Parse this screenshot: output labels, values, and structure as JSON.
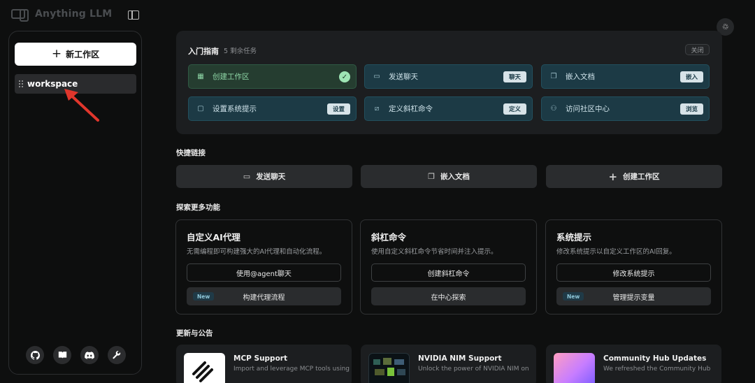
{
  "app": {
    "logo_text": "Anything LLM"
  },
  "sidebar": {
    "new_workspace_label": "新工作区",
    "workspaces": [
      {
        "name": "workspace"
      }
    ],
    "footer_icons": [
      "github-icon",
      "docs-book-icon",
      "discord-icon",
      "wrench-icon"
    ]
  },
  "guide": {
    "title": "入门指南",
    "remaining": "5 剩余任务",
    "close_label": "关闭",
    "tasks": [
      {
        "label": "创建工作区",
        "done": true,
        "icon": "grid-icon"
      },
      {
        "label": "发送聊天",
        "button": "聊天",
        "icon": "chat-icon"
      },
      {
        "label": "嵌入文档",
        "button": "嵌入",
        "icon": "document-icon"
      },
      {
        "label": "设置系统提示",
        "button": "设置",
        "icon": "monitor-icon"
      },
      {
        "label": "定义斜杠命令",
        "button": "定义",
        "icon": "slash-icon"
      },
      {
        "label": "访问社区中心",
        "button": "浏览",
        "icon": "community-icon"
      }
    ]
  },
  "quick_links": {
    "title": "快捷链接",
    "items": [
      {
        "label": "发送聊天",
        "icon": "chat-icon"
      },
      {
        "label": "嵌入文档",
        "icon": "document-icon"
      },
      {
        "label": "创建工作区",
        "icon": "plus-icon"
      }
    ]
  },
  "explore": {
    "title": "探索更多功能",
    "cards": [
      {
        "title": "自定义AI代理",
        "desc": "无需编程即可构建强大的AI代理和自动化流程。",
        "primary": "使用@agent聊天",
        "secondary": "构建代理流程",
        "secondary_tag": "New"
      },
      {
        "title": "斜杠命令",
        "desc": "使用自定义斜杠命令节省时间并注入提示。",
        "primary": "创建斜杠命令",
        "secondary": "在中心探索"
      },
      {
        "title": "系统提示",
        "desc": "修改系统提示以自定义工作区的AI回复。",
        "primary": "修改系统提示",
        "secondary": "管理提示变量",
        "secondary_tag": "New"
      }
    ]
  },
  "updates": {
    "title": "更新与公告",
    "items": [
      {
        "title": "MCP Support",
        "desc": "Import and leverage MCP tools using"
      },
      {
        "title": "NVIDIA NIM Support",
        "desc": "Unlock the power of NVIDIA NIM on"
      },
      {
        "title": "Community Hub Updates",
        "desc": "We refreshed the Community Hub"
      }
    ]
  }
}
